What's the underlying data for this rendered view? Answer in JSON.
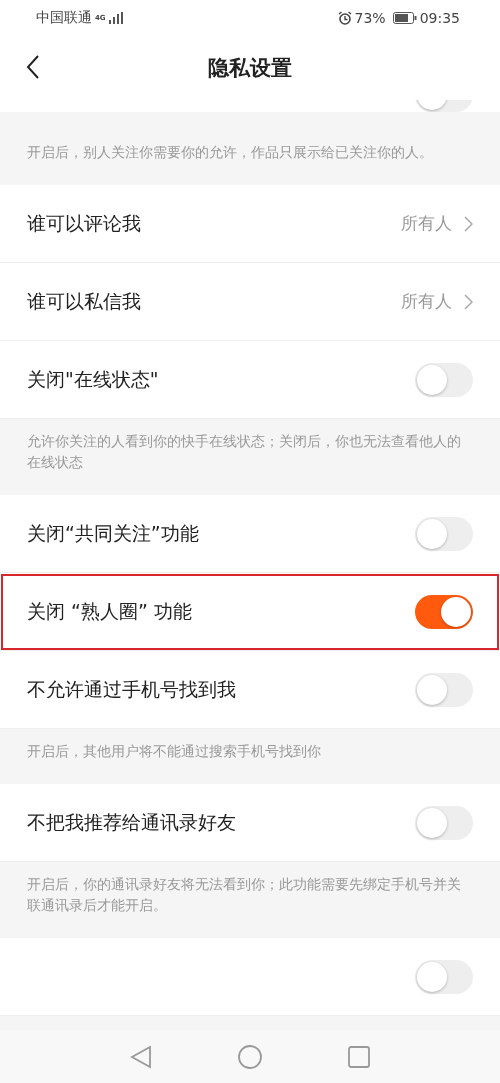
{
  "status_bar": {
    "carrier": "中国联通",
    "network": "4G",
    "battery": "73%",
    "time": "09:35"
  },
  "header": {
    "title": "隐私设置"
  },
  "items": [
    {
      "kind": "toggle_cut",
      "on": false
    },
    {
      "kind": "note",
      "text": "开启后，别人关注你需要你的允许，作品只展示给已关注你的人。"
    },
    {
      "kind": "link",
      "label": "谁可以评论我",
      "value": "所有人"
    },
    {
      "kind": "link",
      "label": "谁可以私信我",
      "value": "所有人"
    },
    {
      "kind": "toggle",
      "label": "关闭\"在线状态\"",
      "on": false,
      "highlighted": false
    },
    {
      "kind": "note",
      "text": "允许你关注的人看到你的快手在线状态；关闭后，你也无法查看他人的在线状态"
    },
    {
      "kind": "toggle",
      "label": "关闭“共同关注”功能",
      "on": false,
      "highlighted": false
    },
    {
      "kind": "toggle",
      "label": "关闭 “熟人圈” 功能",
      "on": true,
      "highlighted": true
    },
    {
      "kind": "toggle",
      "label": "不允许通过手机号找到我",
      "on": false,
      "highlighted": false
    },
    {
      "kind": "note",
      "text": "开启后，其他用户将不能通过搜索手机号找到你"
    },
    {
      "kind": "toggle",
      "label": "不把我推荐给通讯录好友",
      "on": false,
      "highlighted": false
    },
    {
      "kind": "note",
      "text": "开启后，你的通讯录好友将无法看到你；此功能需要先绑定手机号并关联通讯录后才能开启。"
    },
    {
      "kind": "toggle_hidden",
      "on": false
    }
  ]
}
